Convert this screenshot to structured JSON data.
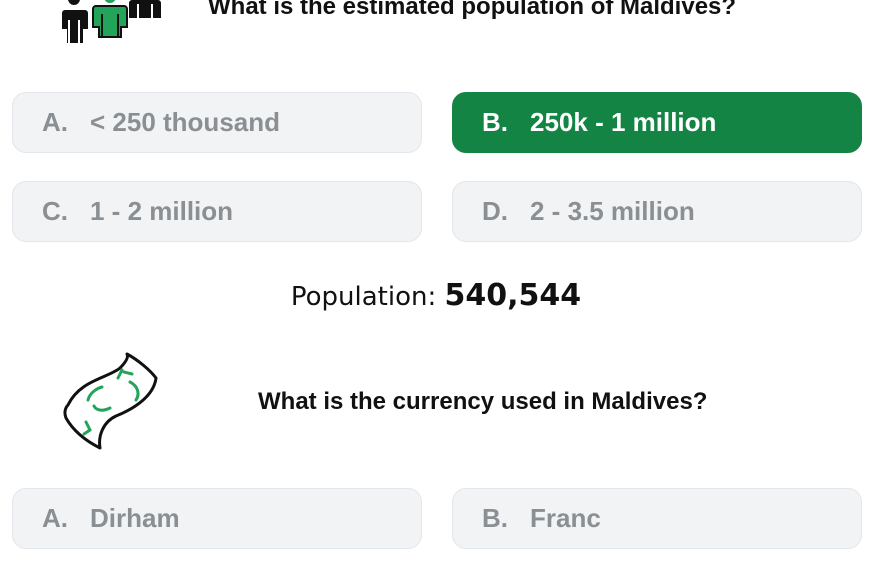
{
  "question1": {
    "icon": "people-icon",
    "title": "What is the estimated population of Maldives?",
    "options": [
      {
        "letter": "A.",
        "label": "< 250 thousand",
        "selected": false
      },
      {
        "letter": "B.",
        "label": "250k - 1 million",
        "selected": true
      },
      {
        "letter": "C.",
        "label": "1 - 2 million",
        "selected": false
      },
      {
        "letter": "D.",
        "label": "2 - 3.5 million",
        "selected": false
      }
    ]
  },
  "population": {
    "label": "Population:",
    "value": "540,544"
  },
  "question2": {
    "icon": "money-bill-icon",
    "title": "What is the currency used in Maldives?",
    "options": [
      {
        "letter": "A.",
        "label": "Dirham",
        "selected": false
      },
      {
        "letter": "B.",
        "label": "Franc",
        "selected": false
      }
    ]
  },
  "colors": {
    "selected_bg": "#148445",
    "option_bg": "#f1f3f5",
    "option_text": "#8a8f94",
    "icon_green": "#22a55a"
  }
}
